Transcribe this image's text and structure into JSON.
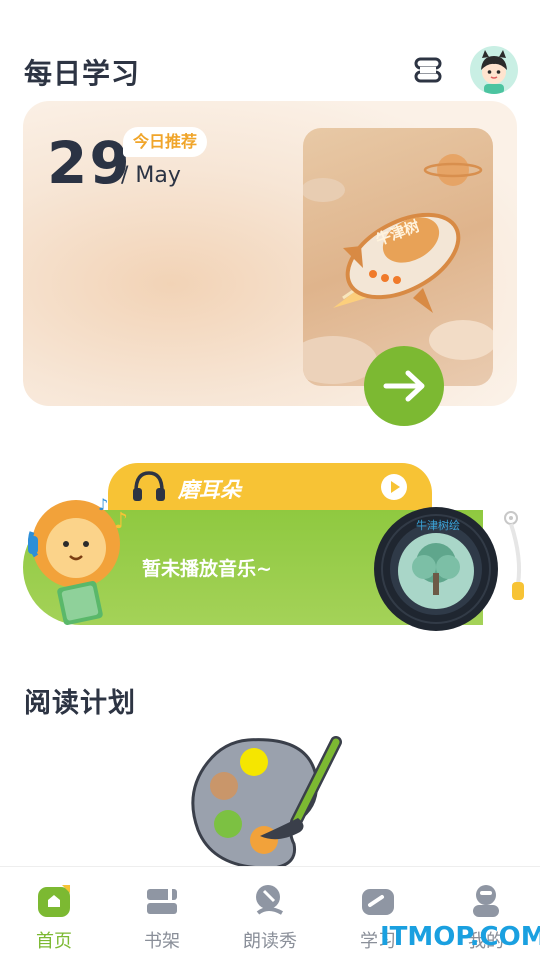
{
  "header": {
    "title": "每日学习",
    "icons": [
      "layers-icon",
      "avatar-icon"
    ]
  },
  "recommendation": {
    "day": "29",
    "month": "/ May",
    "badge": "今日推荐",
    "image_caption": "牛津树",
    "action_icon": "arrow-right-icon"
  },
  "music": {
    "title": "磨耳朵",
    "status": "暂未播放音乐~",
    "record_label": "牛津树绘",
    "icons": [
      "headphones-icon",
      "play-icon",
      "vinyl-record-icon",
      "tonearm-icon",
      "lion-mascot-icon"
    ]
  },
  "reading_plan": {
    "title": "阅读计划",
    "empty_icon": "palette-icon"
  },
  "tabbar": {
    "items": [
      {
        "label": "首页",
        "icon": "home-icon",
        "active": true
      },
      {
        "label": "书架",
        "icon": "bookshelf-icon",
        "active": false
      },
      {
        "label": "朗读秀",
        "icon": "microphone-icon",
        "active": false
      },
      {
        "label": "学习",
        "icon": "study-icon",
        "active": false
      },
      {
        "label": "我的",
        "icon": "profile-icon",
        "active": false
      }
    ]
  },
  "watermark": "ITMOP.COM",
  "colors": {
    "accent_green": "#7cb932",
    "accent_yellow": "#f7c335",
    "badge_text": "#f0a52a",
    "title_text": "#2d3443",
    "tab_inactive": "#8a8f99"
  }
}
